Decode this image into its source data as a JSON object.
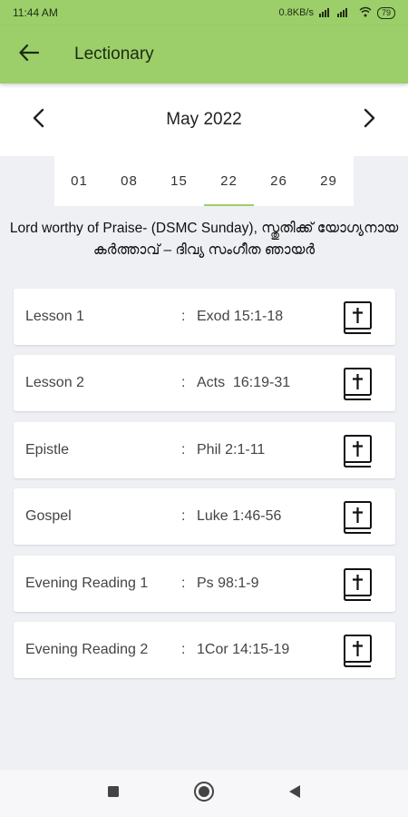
{
  "status_bar": {
    "time": "11:44 AM",
    "network_speed": "0.8KB/s",
    "battery": "79"
  },
  "app_bar": {
    "title": "Lectionary",
    "back_icon": "arrow-left-icon"
  },
  "calendar": {
    "month_label": "May 2022",
    "prev_icon": "chevron-left-icon",
    "next_icon": "chevron-right-icon",
    "dates": [
      "01",
      "08",
      "15",
      "22",
      "26",
      "29"
    ],
    "selected_date": "22"
  },
  "day_title": "Lord worthy of Praise- (DSMC Sunday), സ്തുതിക്ക് യോഗ്യനായ കർത്താവ് – ദിവ്യ സംഗീത ഞായർ",
  "readings": [
    {
      "label": "Lesson 1",
      "reference": "Exod 15:1-18"
    },
    {
      "label": "Lesson 2",
      "reference": "Acts  16:19-31"
    },
    {
      "label": "Epistle",
      "reference": "Phil 2:1-11"
    },
    {
      "label": "Gospel",
      "reference": "Luke 1:46-56"
    },
    {
      "label": "Evening Reading 1",
      "reference": "Ps 98:1-9"
    },
    {
      "label": "Evening Reading 2",
      "reference": "1Cor 14:15-19"
    }
  ],
  "reading_separator": ":",
  "reading_icon": "bible-icon",
  "colors": {
    "accent": "#9ccf6a",
    "background": "#eef0f4",
    "card": "#ffffff"
  },
  "nav_bar": {
    "icons": [
      "recent-apps-icon",
      "home-icon",
      "back-triangle-icon"
    ]
  }
}
